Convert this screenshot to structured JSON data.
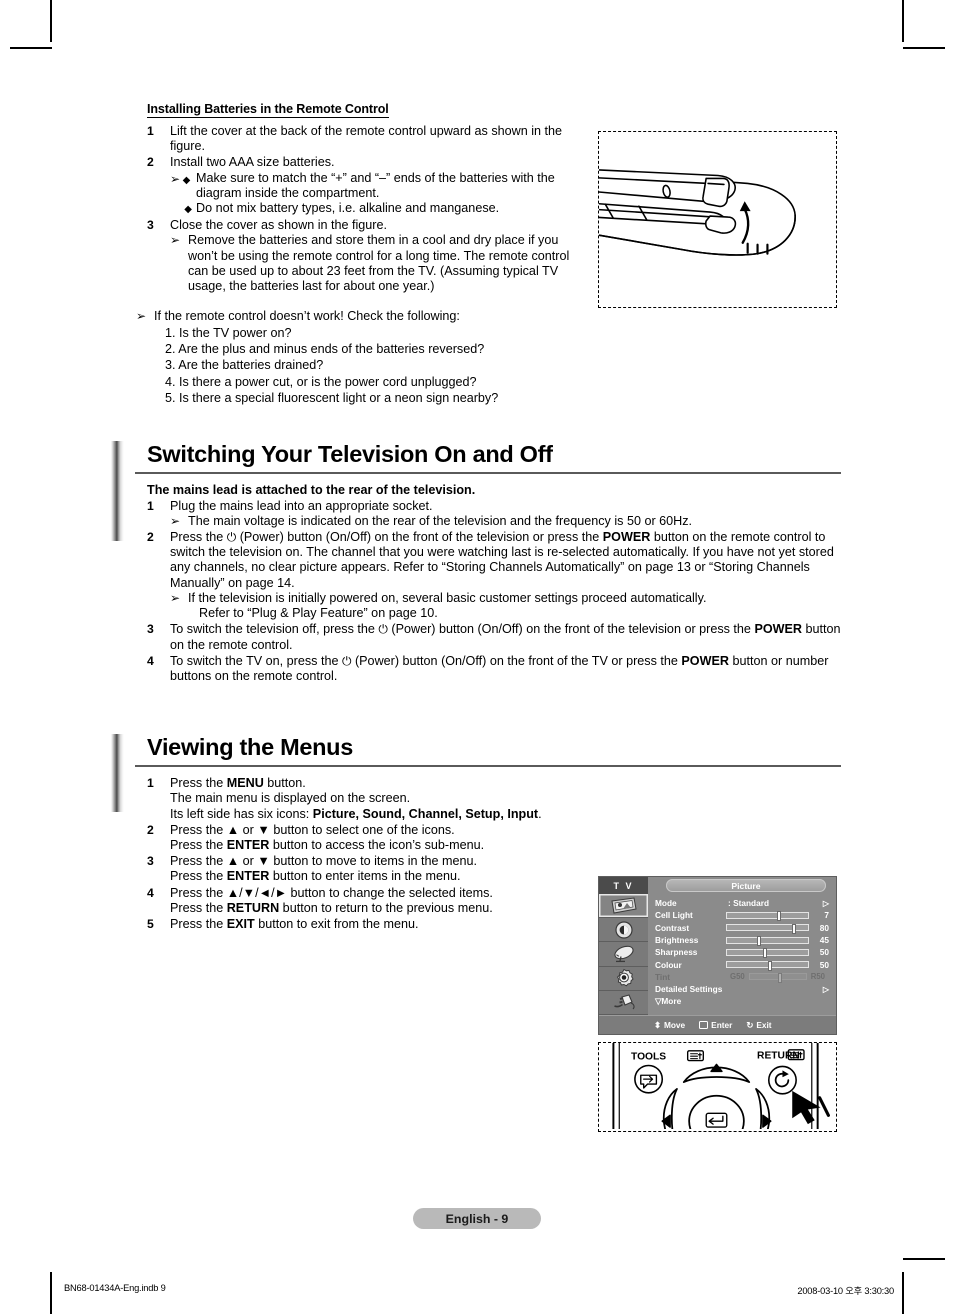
{
  "page": {
    "page_tag": "English - 9",
    "colofon_left": "BN68-01434A-Eng.indb   9",
    "colofon_right": "2008-03-10   오후 3:30:30"
  },
  "battery_section": {
    "heading": "Installing Batteries in the Remote Control",
    "steps": [
      {
        "num": "1",
        "text": "Lift the cover at the back of the remote control upward as shown in the figure."
      },
      {
        "num": "2",
        "text": "Install two AAA size batteries.",
        "diamonds": [
          "Make sure to match the “+” and “–” ends of the batteries with the diagram inside the compartment.",
          "Do not mix battery types, i.e. alkaline and manganese."
        ]
      },
      {
        "num": "3",
        "text": "Close the cover as shown in the figure.",
        "note": "Remove the batteries and store them in a cool and dry place if you won’t be using the remote control for a long time. The remote control can be used up to about 23 feet from the TV. (Assuming typical TV usage, the batteries last for about one year.)"
      }
    ],
    "troubleshoot": {
      "intro": "If the remote control doesn’t work! Check the following:",
      "items": [
        "1. Is the TV power on?",
        "2. Are the plus and minus ends of the batteries reversed?",
        "3. Are the batteries drained?",
        "4. Is there a power cut, or is the power cord unplugged?",
        "5. Is there a special fluorescent light or a neon sign nearby?"
      ]
    },
    "figure_name": "remote-control-battery-cover-illustration"
  },
  "switching_section": {
    "title": "Switching Your Television On and Off",
    "lead": "The mains lead is attached to the rear of the television.",
    "steps": [
      {
        "num": "1",
        "text": "Plug the mains lead into an appropriate socket.",
        "note": "The main voltage is indicated on the rear of the television and the frequency is 50 or 60Hz."
      },
      {
        "num": "2",
        "text_a": "Press the ",
        "text_b": " (Power) button (On/Off) on the front of the television or press the ",
        "bold_1": "POWER",
        "text_c": " button on the remote control to switch the television on. The channel that you were watching last is re-selected automatically. If you have not yet stored any channels, no clear picture appears. Refer to “Storing Channels Automatically” on page 13 or “Storing Channels Manually” on page 14.",
        "note_a": "If the television is initially powered on, several basic customer settings proceed automatically.",
        "note_b": "Refer to “Plug & Play Feature” on page 10."
      },
      {
        "num": "3",
        "text_a": "To switch the television off, press the ",
        "text_b": " (Power) button (On/Off) on the front of the television or press the ",
        "bold_1": "POWER",
        "text_c": " button on the remote control."
      },
      {
        "num": "4",
        "text_a": "To switch the TV on, press the ",
        "text_b": " (Power) button (On/Off) on the front of the TV or press the ",
        "bold_1": "POWER",
        "text_c": " button or number buttons on the remote control."
      }
    ],
    "power_glyph": "⏻"
  },
  "menus_section": {
    "title": "Viewing the Menus",
    "steps": [
      {
        "num": "1",
        "l1_a": "Press the ",
        "l1_b": "MENU",
        "l1_c": " button.",
        "l2": "The main menu is displayed on the screen.",
        "l3_a": "Its left side has six icons: ",
        "l3_bold": "Picture, Sound, Channel, Setup, Input",
        "l3_c": "."
      },
      {
        "num": "2",
        "l1_a": "Press the ▲ or ▼ button to select one of the icons.",
        "l2_a": "Press the ",
        "l2_b": "ENTER",
        "l2_c": " button to access the icon’s sub-menu."
      },
      {
        "num": "3",
        "l1_a": "Press the ▲ or ▼ button to move to items in the menu.",
        "l2_a": "Press the ",
        "l2_b": "ENTER",
        "l2_c": " button to enter items in the menu."
      },
      {
        "num": "4",
        "l1_a": "Press the ▲/▼/◄/► button to change the selected items.",
        "l2_a": "Press the ",
        "l2_b": "RETURN",
        "l2_c": " button to return to the previous menu."
      },
      {
        "num": "5",
        "l1_a": "Press the ",
        "l1_b": "EXIT",
        "l1_c": " button to exit from the menu."
      }
    ]
  },
  "osd": {
    "source_label": "T V",
    "title": "Picture",
    "icons": [
      "picture-icon",
      "sound-icon",
      "channel-icon",
      "setup-icon",
      "input-icon"
    ],
    "selected_icon_index": 0,
    "rows": [
      {
        "label": "Mode",
        "type": "value",
        "value": ": Standard",
        "chevron": "▷",
        "dim": false
      },
      {
        "label": "Cell Light",
        "type": "slider",
        "value": "7",
        "pct": 62,
        "dim": false
      },
      {
        "label": "Contrast",
        "type": "slider",
        "value": "80",
        "pct": 80,
        "dim": false
      },
      {
        "label": "Brightness",
        "type": "slider",
        "value": "45",
        "pct": 37,
        "dim": false
      },
      {
        "label": "Sharpness",
        "type": "slider",
        "value": "50",
        "pct": 45,
        "dim": false
      },
      {
        "label": "Colour",
        "type": "slider",
        "value": "50",
        "pct": 50,
        "dim": false
      },
      {
        "label": "Tint",
        "type": "slider-gr",
        "left_label": "G50",
        "right_label": "R50",
        "pct": 50,
        "dim": true
      },
      {
        "label": "Detailed Settings",
        "type": "value",
        "value": "",
        "chevron": "▷",
        "dim": false
      }
    ],
    "more_label": "▽More",
    "footer": [
      {
        "icon": "updown-arrow-icon",
        "glyph": "⬍",
        "label": "Move"
      },
      {
        "icon": "enter-key-icon",
        "glyph": "↵",
        "label": "Enter"
      },
      {
        "icon": "exit-loop-icon",
        "glyph": "↻",
        "label": "Exit"
      }
    ]
  },
  "remote_keys_figure": {
    "tools_label": "TOOLS",
    "return_label": "RETURN",
    "figure_name": "remote-control-navigation-keys-illustration"
  }
}
